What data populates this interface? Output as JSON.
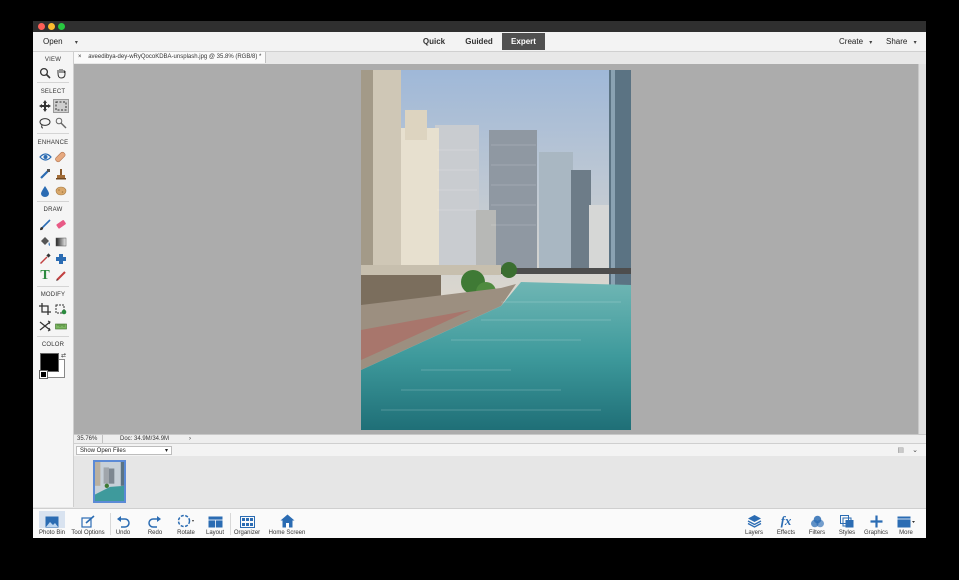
{
  "menubar": {
    "open_label": "Open",
    "modes": [
      "Quick",
      "Guided",
      "Expert"
    ],
    "active_mode": "Expert",
    "create_label": "Create",
    "share_label": "Share"
  },
  "toolbox": {
    "sections": {
      "view": "VIEW",
      "select": "SELECT",
      "enhance": "ENHANCE",
      "draw": "DRAW",
      "modify": "MODIFY",
      "color": "COLOR"
    },
    "text_tool_glyph": "T",
    "tool_icons": [
      "zoom-tool",
      "hand-tool",
      "move-tool",
      "marquee-tool",
      "lasso-tool",
      "quick-selection-tool",
      "red-eye-tool",
      "spot-healing-tool",
      "smart-brush-tool",
      "clone-stamp-tool",
      "blur-tool",
      "sponge-tool",
      "brush-tool",
      "eraser-tool",
      "paint-bucket-tool",
      "gradient-tool",
      "color-picker-tool",
      "custom-shape-tool",
      "type-tool",
      "pencil-tool",
      "crop-tool",
      "recompose-tool",
      "content-aware-move-tool",
      "straighten-tool"
    ],
    "foreground_color": "#000000",
    "background_color": "#ffffff"
  },
  "document": {
    "tab_close": "×",
    "tab_title": "aveedibya-dey-wRyQocoKDBA-unsplash.jpg @ 35.8% (RGB/8) *",
    "zoom": "35.76%",
    "doc_size": "Doc: 34.9M/34.9M"
  },
  "photo_bin": {
    "dropdown_value": "Show Open Files"
  },
  "bottom_left": [
    {
      "label": "Photo Bin",
      "icon": "photo-bin-icon"
    },
    {
      "label": "Tool Options",
      "icon": "tool-options-icon"
    },
    {
      "label": "Undo",
      "icon": "undo-icon"
    },
    {
      "label": "Redo",
      "icon": "redo-icon"
    },
    {
      "label": "Rotate",
      "icon": "rotate-icon"
    },
    {
      "label": "Layout",
      "icon": "layout-icon"
    },
    {
      "label": "Organizer",
      "icon": "organizer-icon"
    },
    {
      "label": "Home Screen",
      "icon": "home-icon"
    }
  ],
  "bottom_right": [
    {
      "label": "Layers",
      "icon": "layers-icon"
    },
    {
      "label": "Effects",
      "icon": "effects-icon"
    },
    {
      "label": "Filters",
      "icon": "filters-icon"
    },
    {
      "label": "Styles",
      "icon": "styles-icon"
    },
    {
      "label": "Graphics",
      "icon": "graphics-icon"
    },
    {
      "label": "More",
      "icon": "more-icon"
    }
  ],
  "colors": {
    "accent_blue": "#2b6cb3",
    "active_tab": "#505050",
    "canvas_bg": "#acacac",
    "water": "#3f9c9c"
  }
}
